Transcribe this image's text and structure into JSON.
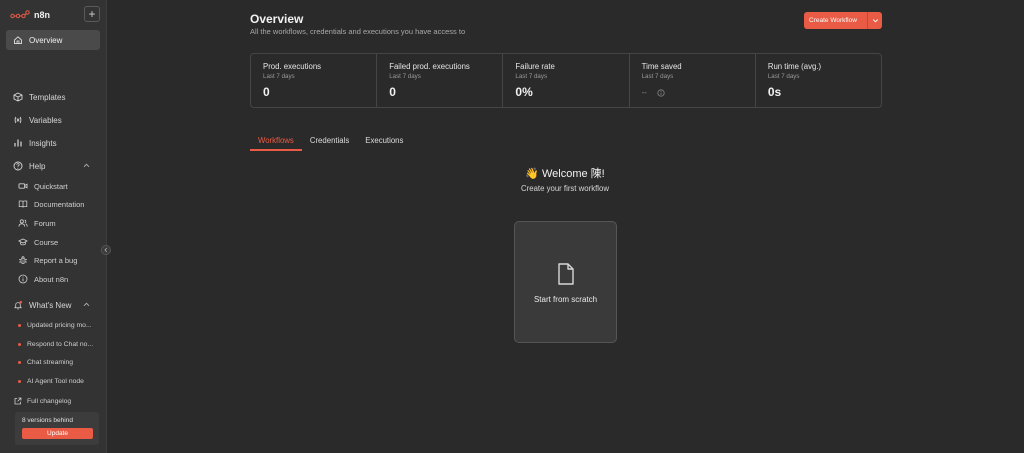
{
  "app": {
    "brand_name": "n8n",
    "add_symbol": "+",
    "accent_color": "#ea5b45"
  },
  "sidebar": {
    "overview_label": "Overview",
    "nav": [
      {
        "label": "Templates",
        "icon": "box-icon"
      },
      {
        "label": "Variables",
        "icon": "variable-icon"
      },
      {
        "label": "Insights",
        "icon": "chart-icon"
      },
      {
        "label": "Help",
        "icon": "question-icon"
      }
    ],
    "help_items": [
      {
        "label": "Quickstart",
        "icon": "video-icon"
      },
      {
        "label": "Documentation",
        "icon": "book-icon"
      },
      {
        "label": "Forum",
        "icon": "users-icon"
      },
      {
        "label": "Course",
        "icon": "graduation-cap-icon"
      },
      {
        "label": "Report a bug",
        "icon": "bug-icon"
      },
      {
        "label": "About n8n",
        "icon": "info-icon"
      }
    ],
    "whats_new_label": "What's New",
    "news_items": [
      "Updated pricing mo...",
      "Respond to Chat no...",
      "Chat streaming",
      "AI Agent Tool node"
    ],
    "changelog_label": "Full changelog",
    "update": {
      "text": "8 versions behind",
      "button_label": "Update"
    }
  },
  "header": {
    "title": "Overview",
    "subtitle": "All the workflows, credentials and executions you have access to",
    "create_button_label": "Create Workflow"
  },
  "stats": [
    {
      "label": "Prod. executions",
      "period": "Last 7 days",
      "value": "0"
    },
    {
      "label": "Failed prod. executions",
      "period": "Last 7 days",
      "value": "0"
    },
    {
      "label": "Failure rate",
      "period": "Last 7 days",
      "value": "0%"
    },
    {
      "label": "Time saved",
      "period": "Last 7 days",
      "value": "--"
    },
    {
      "label": "Run time (avg.)",
      "period": "Last 7 days",
      "value": "0s"
    }
  ],
  "tabs": [
    {
      "label": "Workflows",
      "active": true
    },
    {
      "label": "Credentials",
      "active": false
    },
    {
      "label": "Executions",
      "active": false
    }
  ],
  "empty_state": {
    "welcome": "👋 Welcome 陳!",
    "subtitle": "Create your first workflow",
    "card_label": "Start from scratch"
  }
}
